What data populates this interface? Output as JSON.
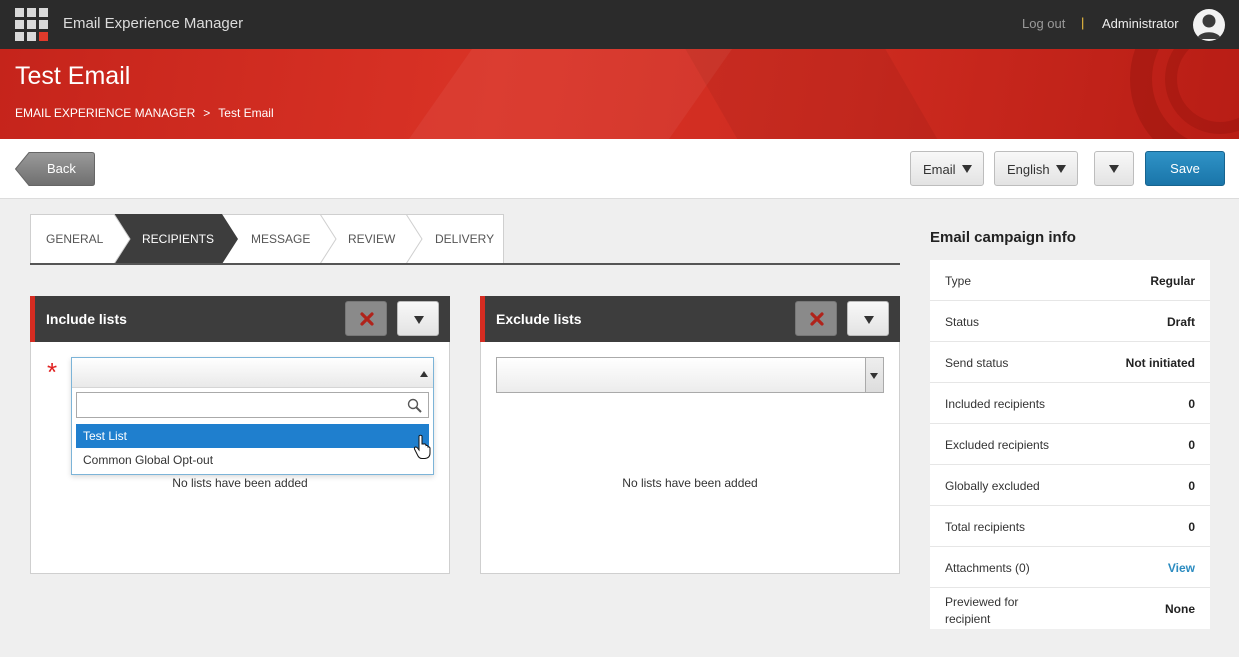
{
  "header": {
    "app_title": "Email Experience Manager",
    "logout": "Log out",
    "separator": "|",
    "user": "Administrator",
    "icons": [
      "app-grid-icon",
      "user-avatar-icon"
    ]
  },
  "banner": {
    "title": "Test Email",
    "breadcrumb": [
      "EMAIL EXPERIENCE MANAGER",
      ">",
      "Test Email"
    ]
  },
  "toolbar": {
    "back_label": "Back",
    "type_select": "Email",
    "language_select": "English",
    "save_label": "Save"
  },
  "tabs": [
    {
      "label": "GENERAL",
      "active": false
    },
    {
      "label": "RECIPIENTS",
      "active": true
    },
    {
      "label": "MESSAGE",
      "active": false
    },
    {
      "label": "REVIEW",
      "active": false
    },
    {
      "label": "DELIVERY",
      "active": false
    }
  ],
  "include_panel": {
    "title": "Include lists",
    "required_marker": "*",
    "search_placeholder": "",
    "options": [
      "Test List",
      "Common Global Opt-out"
    ],
    "selected_option": "Test List",
    "empty_message": "No lists have been added"
  },
  "exclude_panel": {
    "title": "Exclude lists",
    "empty_message": "No lists have been added"
  },
  "campaign_info": {
    "title": "Email campaign info",
    "rows": [
      {
        "key": "Type",
        "value": "Regular"
      },
      {
        "key": "Status",
        "value": "Draft"
      },
      {
        "key": "Send status",
        "value": "Not initiated"
      },
      {
        "key": "Included recipients",
        "value": "0"
      },
      {
        "key": "Excluded recipients",
        "value": "0"
      },
      {
        "key": "Globally excluded",
        "value": "0"
      },
      {
        "key": "Total recipients",
        "value": "0"
      },
      {
        "key": "Attachments (0)",
        "value": "View"
      },
      {
        "key": "Previewed for recipient",
        "value": "None"
      }
    ]
  },
  "colors": {
    "banner_red": "#d52c21",
    "save_blue": "#1f7fc0",
    "selected_option": "#1f7fce",
    "link": "#2b8bc0"
  }
}
